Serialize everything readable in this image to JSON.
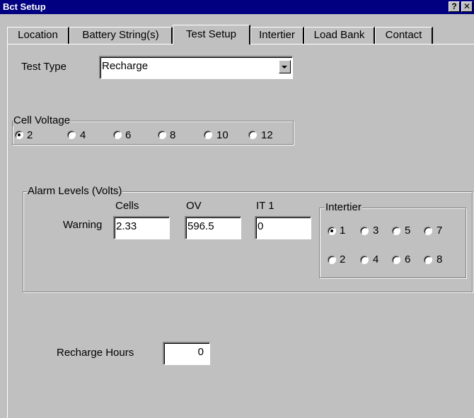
{
  "window": {
    "title": "Bct Setup",
    "help_label": "?",
    "close_label": "✕"
  },
  "tabs": [
    {
      "label": "Location"
    },
    {
      "label": "Battery String(s)"
    },
    {
      "label": "Test Setup",
      "active": true
    },
    {
      "label": "Intertier"
    },
    {
      "label": "Load Bank"
    },
    {
      "label": "Contact"
    }
  ],
  "test_type": {
    "label": "Test Type",
    "value": "Recharge"
  },
  "cell_voltage": {
    "label": "Cell Voltage",
    "options": [
      "2",
      "4",
      "6",
      "8",
      "10",
      "12"
    ],
    "selected": "2"
  },
  "alarm_levels": {
    "label": "Alarm Levels (Volts)",
    "row_label": "Warning",
    "columns": [
      {
        "header": "Cells",
        "value": "2.33"
      },
      {
        "header": "OV",
        "value": "596.5"
      },
      {
        "header": "IT 1",
        "value": "0"
      }
    ]
  },
  "intertier": {
    "label": "Intertier",
    "options": [
      "1",
      "3",
      "5",
      "7",
      "2",
      "4",
      "6",
      "8"
    ],
    "selected": "1"
  },
  "recharge_hours": {
    "label": "Recharge Hours",
    "value": "0"
  }
}
